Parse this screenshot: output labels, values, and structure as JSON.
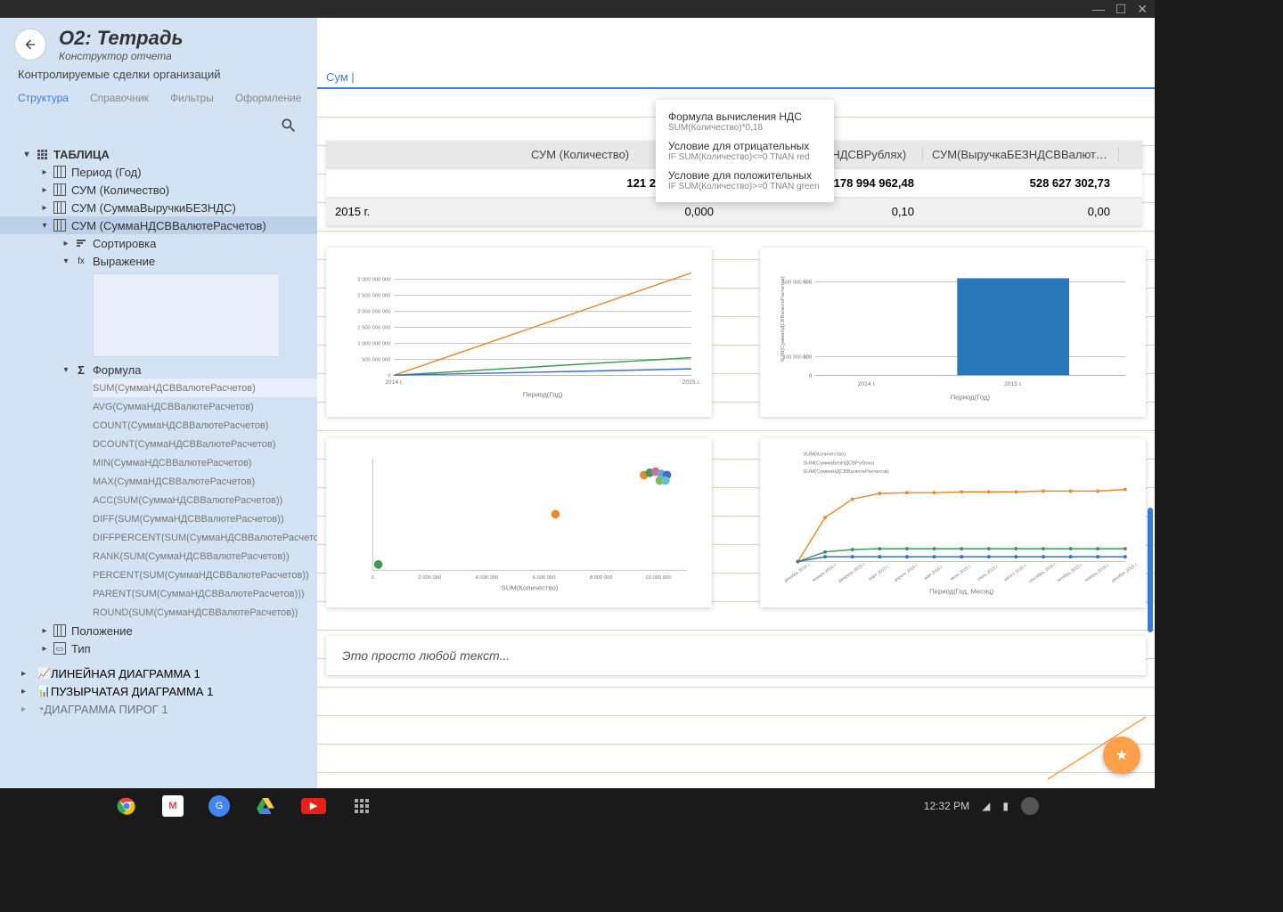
{
  "header": {
    "title": "О2: Тетрадь",
    "subtitle": "Конструктор отчета",
    "description": "Контролируемые сделки организаций"
  },
  "tabs": [
    "Структура",
    "Справочник",
    "Фильтры",
    "Оформление"
  ],
  "tree": {
    "table": "ТАБЛИЦА",
    "columns": [
      "Период (Год)",
      "СУМ (Количество)",
      "СУМ (СуммаВыручкиБЕЗНДС)",
      "СУМ (СуммаНДСВВалютеРасчетов)"
    ],
    "sort": "Сортировка",
    "expr": "Выражение",
    "formula": "Формула",
    "formulas": [
      "SUM(СуммаНДСВВалютеРасчетов)",
      "AVG(СуммаНДСВВалютеРасчетов)",
      "COUNT(СуммаНДСВВалютеРасчетов)",
      "DCOUNT(СуммаНДСВВалютеРасчетов)",
      "MIN(СуммаНДСВВалютеРасчетов)",
      "MAX(СуммаНДСВВалютеРасчетов)",
      "ACC(SUM(СуммаНДСВВалютеРасчетов))",
      "DIFF(SUM(СуммаНДСВВалютеРасчетов))",
      "DIFFPERCENT(SUM(СуммаНДСВВалютеРасчетов))",
      "RANK(SUM(СуммаНДСВВалютеРасчетов))",
      "PERCENT(SUM(СуммаНДСВВалютеРасчетов))",
      "PARENT(SUM(СуммаНДСВВалютеРасчетов)))",
      "ROUND(SUM(СуммаНДСВВалютеРасчетов))"
    ],
    "position": "Положение",
    "type": "Тип",
    "groups": [
      "ЛИНЕЙНАЯ ДИАГРАММА 1",
      "ПУЗЫРЧАТАЯ ДИАГРАММА 1",
      "ДИАГРАММА ПИРОГ 1"
    ]
  },
  "formula_input": "Сум |",
  "suggest": [
    {
      "t": "Формула вычисления НДС",
      "s": "SUM(Количество)*0,18"
    },
    {
      "t": "Условие для отрицательных",
      "s": "IF SUM(Количество)<=0  TNAN red"
    },
    {
      "t": "Условие для положительных",
      "s": "IF SUM(Количество)>=0  TNAN green"
    }
  ],
  "table": {
    "headers": [
      "",
      "СУМ (Количество)",
      "СУМ (ВыручкаБЕЗНДСВРублях)",
      "СУМ(ВыручкаБЕЗНДСВВалютеР..."
    ],
    "rows": [
      [
        "",
        "121 247 449,593",
        "3 178 994 962,48",
        "528 627 302,73"
      ],
      [
        "2015 г.",
        "0,000",
        "0,10",
        "0,00"
      ]
    ]
  },
  "text_block": "Это просто любой текст...",
  "taskbar": {
    "time": "12:32 PM"
  },
  "chart_data": [
    {
      "type": "line",
      "xlabel": "Период(Год)",
      "ylabel": "",
      "categories": [
        "2014 г.",
        "2015 г."
      ],
      "ylim": [
        0,
        3500000000
      ],
      "yticks": [
        0,
        500000000,
        1000000000,
        1500000000,
        2000000000,
        2500000000,
        3000000000
      ],
      "series": [
        {
          "name": "orange",
          "color": "#e68a2e",
          "values": [
            0,
            3200000000
          ]
        },
        {
          "name": "green",
          "color": "#3c9a4e",
          "values": [
            0,
            550000000
          ]
        },
        {
          "name": "blue",
          "color": "#3b6fc7",
          "values": [
            0,
            200000000
          ]
        }
      ]
    },
    {
      "type": "bar",
      "xlabel": "Период(Год)",
      "ylabel": "SUM(СуммаНДСВВалютеРасчетов)",
      "categories": [
        "2014 г.",
        "2015 г."
      ],
      "ylim": [
        0,
        600000000
      ],
      "yticks": [
        0,
        100000000,
        500000000
      ],
      "values": [
        0,
        520000000
      ],
      "color": "#2976b8"
    },
    {
      "type": "scatter",
      "xlabel": "SUM(Количество)",
      "ylabel": "",
      "xlim": [
        0,
        11000000
      ],
      "xticks": [
        0,
        2000000,
        4000000,
        6000000,
        8000000,
        10000000
      ],
      "points": [
        {
          "x": 200000,
          "y": 5,
          "color": "#3c9a4e"
        },
        {
          "x": 6400000,
          "y": 50,
          "color": "#e68a2e"
        },
        {
          "x": 9500000,
          "y": 85,
          "color": "#e68a2e"
        },
        {
          "x": 9700000,
          "y": 87,
          "color": "#3c9a4e"
        },
        {
          "x": 9900000,
          "y": 88,
          "color": "#d46a9a"
        },
        {
          "x": 10100000,
          "y": 86,
          "color": "#6aa8d4"
        },
        {
          "x": 10300000,
          "y": 85,
          "color": "#3b6fc7"
        },
        {
          "x": 10050000,
          "y": 80,
          "color": "#7ab86a"
        },
        {
          "x": 10250000,
          "y": 80,
          "color": "#5ac7c0"
        }
      ]
    },
    {
      "type": "line",
      "xlabel": "Период(Год, Месяц)",
      "legend": [
        "SUM(Количество)",
        "SUM(СуммаБезНДСВРублях)",
        "SUM(СуммаНДСВВалютеРасчетов)"
      ],
      "categories": [
        "декабрь 2014 г.",
        "январь 2015 г.",
        "февраль 2015 г.",
        "март 2015 г.",
        "апрель 2015 г.",
        "май 2015 г.",
        "июнь 2015 г.",
        "июль 2015 г.",
        "август 2015 г.",
        "сентябрь 2015 г.",
        "октябрь 2015 г.",
        "ноябрь 2015 г.",
        "декабрь 2015 г."
      ],
      "series": [
        {
          "name": "SUM(Количество)",
          "color": "#e68a2e",
          "values": [
            0,
            55,
            78,
            85,
            86,
            86,
            87,
            87,
            87,
            88,
            88,
            88,
            90
          ]
        },
        {
          "name": "SUM(СуммаБезНДСВРублях)",
          "color": "#3c9a4e",
          "values": [
            0,
            12,
            15,
            16,
            16,
            16,
            16,
            16,
            16,
            16,
            16,
            16,
            16
          ]
        },
        {
          "name": "SUM(СуммаНДСВВалютеРасчетов)",
          "color": "#3b6fc7",
          "values": [
            0,
            6,
            6,
            6,
            6,
            6,
            6,
            6,
            6,
            6,
            6,
            6,
            6
          ]
        }
      ]
    }
  ]
}
